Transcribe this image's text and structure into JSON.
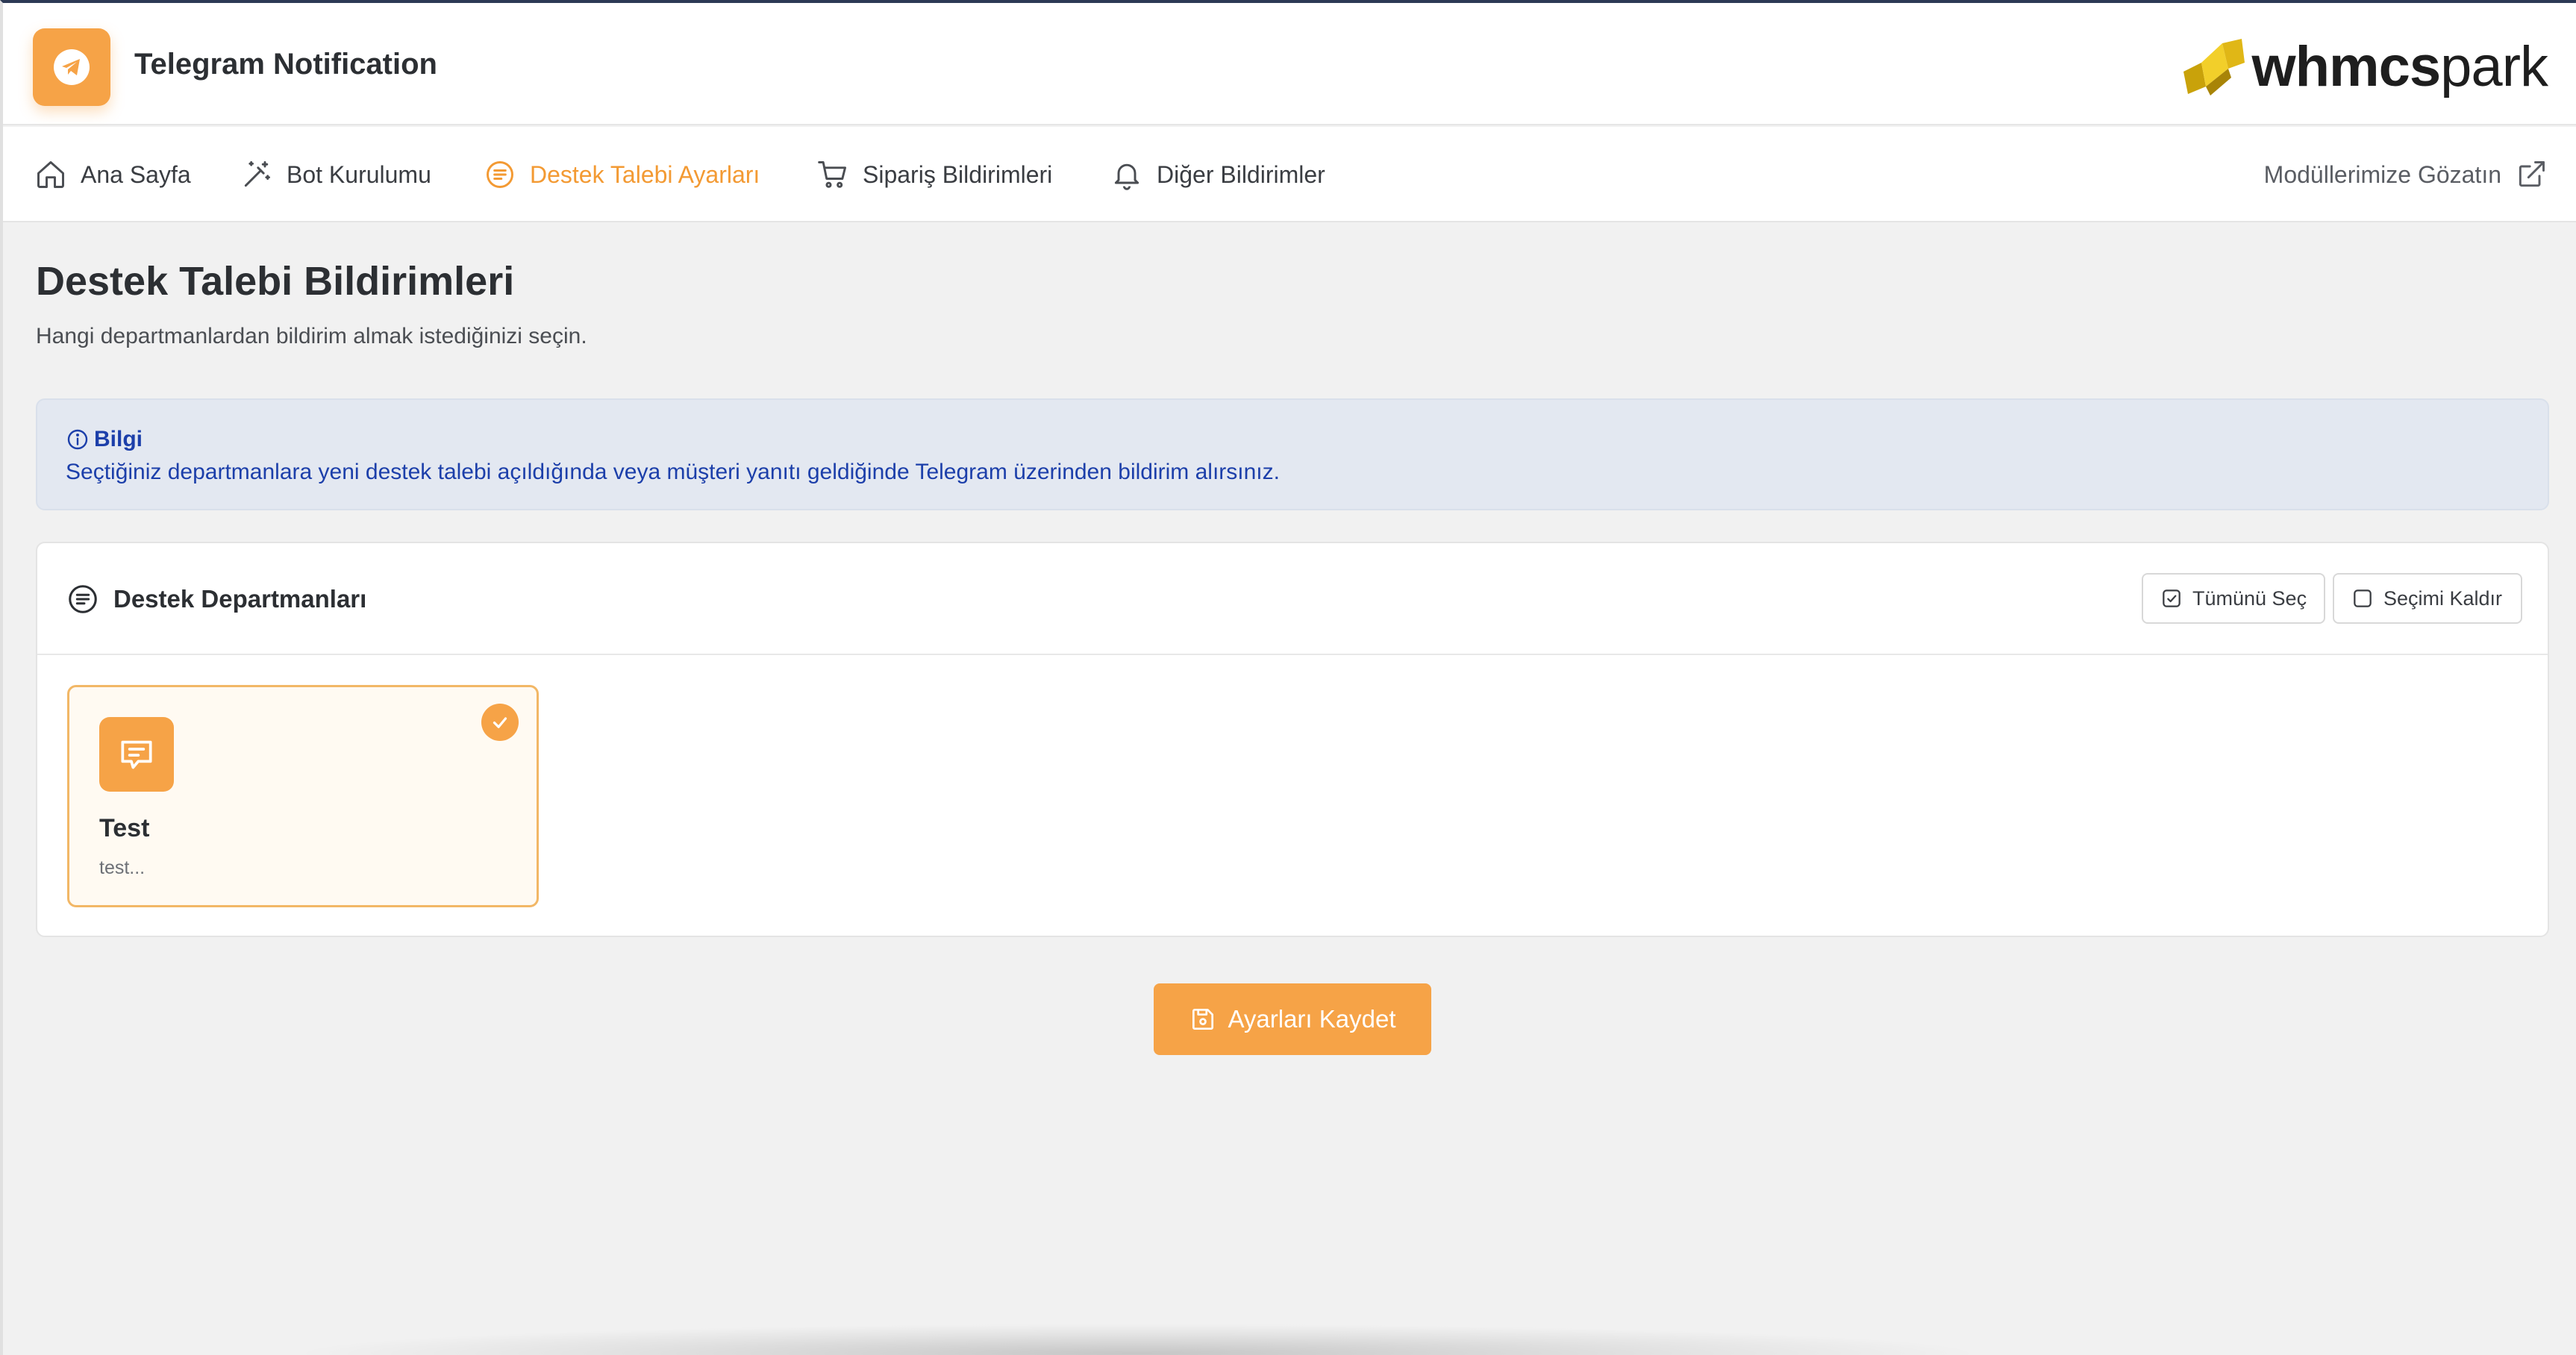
{
  "header": {
    "title": "Telegram Notification",
    "logo_icon": "telegram-icon",
    "brand": {
      "bold": "whmcs",
      "light": "park"
    }
  },
  "nav": {
    "items": [
      {
        "label": "Ana Sayfa",
        "icon": "home-icon"
      },
      {
        "label": "Bot Kurulumu",
        "icon": "magic-wand-icon"
      },
      {
        "label": "Destek Talebi Ayarları",
        "icon": "list-circle-icon",
        "active": true
      },
      {
        "label": "Sipariş Bildirimleri",
        "icon": "cart-icon"
      },
      {
        "label": "Diğer Bildirimler",
        "icon": "bell-icon"
      }
    ],
    "external": {
      "label": "Modüllerimize Gözatın",
      "icon": "external-link-icon"
    }
  },
  "page": {
    "title": "Destek Talebi Bildirimleri",
    "subtitle": "Hangi departmanlardan bildirim almak istediğinizi seçin."
  },
  "info": {
    "title": "Bilgi",
    "text": "Seçtiğiniz departmanlara yeni destek talebi açıldığında veya müşteri yanıtı geldiğinde Telegram üzerinden bildirim alırsınız."
  },
  "departments_panel": {
    "title": "Destek Departmanları",
    "select_all": "Tümünü Seç",
    "clear_selection": "Seçimi Kaldır",
    "items": [
      {
        "name": "Test",
        "description": "test...",
        "selected": true
      }
    ]
  },
  "save_button": {
    "label": "Ayarları Kaydet"
  },
  "colors": {
    "accent": "#f6a347",
    "accent_text": "#f39a33",
    "info_bg": "#e3e8f1",
    "info_text": "#1c3faa"
  }
}
